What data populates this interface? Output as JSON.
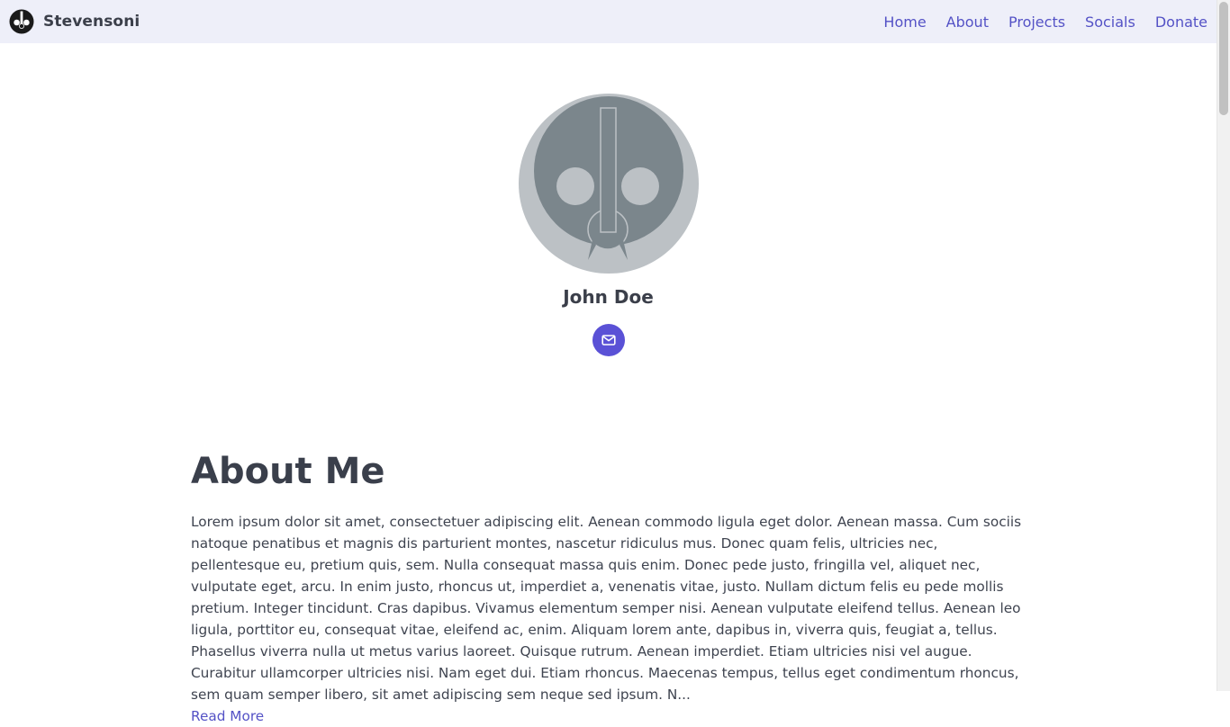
{
  "header": {
    "brand_name": "Stevensoni",
    "nav": [
      {
        "label": "Home"
      },
      {
        "label": "About"
      },
      {
        "label": "Projects"
      },
      {
        "label": "Socials"
      },
      {
        "label": "Donate"
      }
    ]
  },
  "profile": {
    "name": "John Doe",
    "contact_icon": "mail-icon"
  },
  "about": {
    "title": "About Me",
    "text": "Lorem ipsum dolor sit amet, consectetuer adipiscing elit. Aenean commodo ligula eget dolor. Aenean massa. Cum sociis natoque penatibus et magnis dis parturient montes, nascetur ridiculus mus. Donec quam felis, ultricies nec, pellentesque eu, pretium quis, sem. Nulla consequat massa quis enim. Donec pede justo, fringilla vel, aliquet nec, vulputate eget, arcu. In enim justo, rhoncus ut, imperdiet a, venenatis vitae, justo. Nullam dictum felis eu pede mollis pretium. Integer tincidunt. Cras dapibus. Vivamus elementum semper nisi. Aenean vulputate eleifend tellus. Aenean leo ligula, porttitor eu, consequat vitae, eleifend ac, enim. Aliquam lorem ante, dapibus in, viverra quis, feugiat a, tellus. Phasellus viverra nulla ut metus varius laoreet. Quisque rutrum. Aenean imperdiet. Etiam ultricies nisi vel augue. Curabitur ullamcorper ultricies nisi. Nam eget dui. Etiam rhoncus. Maecenas tempus, tellus eget condimentum rhoncus, sem quam semper libero, sit amet adipiscing sem neque sed ipsum. N...",
    "read_more": "Read More"
  },
  "colors": {
    "navbar_bg": "#eeeff9",
    "link": "#5452c6",
    "accent": "#5a51d6",
    "text": "#3a3f4b"
  }
}
